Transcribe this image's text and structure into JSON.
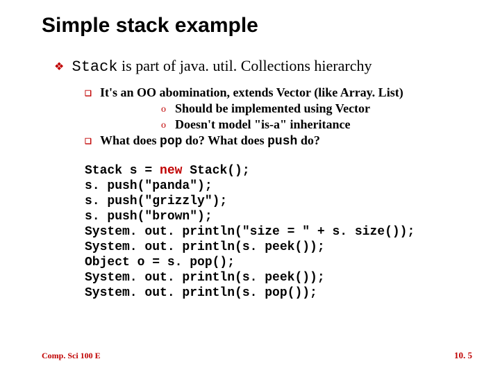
{
  "title": "Simple stack example",
  "main_point": {
    "pre": "Stack",
    "post": " is part of java. util. Collections hierarchy"
  },
  "sub_points": [
    {
      "type": "square",
      "text": "It's an OO abomination, extends Vector (like Array. List)"
    },
    {
      "type": "circle",
      "text": "Should be implemented using Vector"
    },
    {
      "type": "circle",
      "text": "Doesn't model \"is-a\" inheritance"
    },
    {
      "type": "square",
      "pre": "What does ",
      "mono1": "pop",
      "mid": " do? What does ",
      "mono2": "push",
      "post": " do?"
    }
  ],
  "code": {
    "l1a": "Stack s = ",
    "l1kw": "new",
    "l1b": " Stack();",
    "l2": "s. push(\"panda\");",
    "l3": "s. push(\"grizzly\");",
    "l4": "s. push(\"brown\");",
    "l5": "System. out. println(\"size = \" + s. size());",
    "l6": "System. out. println(s. peek());",
    "l7": "Object o = s. pop();",
    "l8": "System. out. println(s. peek());",
    "l9": "System. out. println(s. pop());"
  },
  "footer": "Comp. Sci 100 E",
  "pagenum": "10. 5"
}
